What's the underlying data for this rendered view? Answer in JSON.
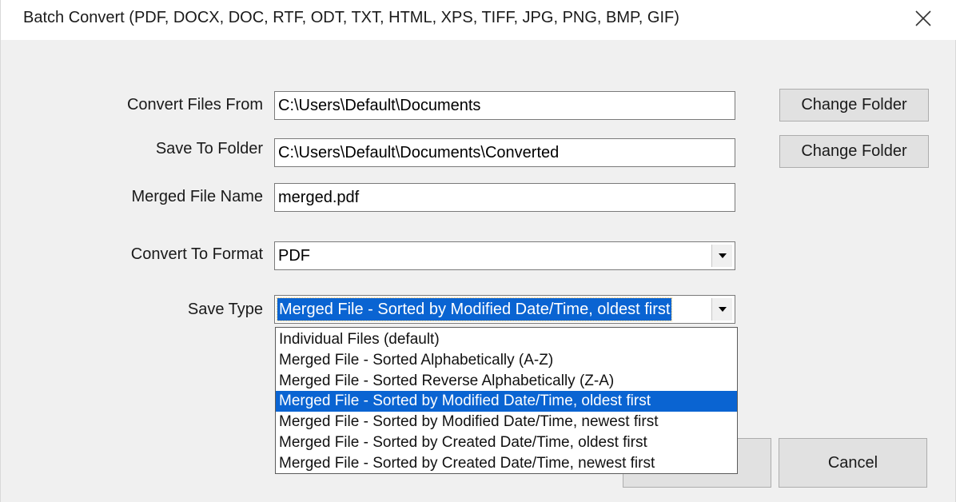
{
  "window": {
    "title": "Batch Convert (PDF, DOCX, DOC, RTF, ODT, TXT, HTML, XPS, TIFF, JPG, PNG, BMP, GIF)"
  },
  "form": {
    "convert_from": {
      "label": "Convert Files From",
      "value": "C:\\Users\\Default\\Documents",
      "button": "Change Folder"
    },
    "save_to": {
      "label": "Save To Folder",
      "value": "C:\\Users\\Default\\Documents\\Converted",
      "button": "Change Folder"
    },
    "merged_name": {
      "label": "Merged File Name",
      "value": "merged.pdf"
    },
    "format": {
      "label": "Convert To Format",
      "value": "PDF"
    },
    "save_type": {
      "label": "Save Type",
      "value": "Merged File - Sorted by Modified Date/Time, oldest first",
      "options": [
        "Individual Files (default)",
        "Merged File - Sorted Alphabetically (A-Z)",
        "Merged File - Sorted Reverse Alphabetically (Z-A)",
        "Merged File - Sorted by Modified Date/Time, oldest first",
        "Merged File - Sorted by Modified Date/Time, newest first",
        "Merged File - Sorted by Created Date/Time, oldest first",
        "Merged File - Sorted by Created Date/Time, newest first"
      ],
      "highlighted_index": 3
    }
  },
  "actions": {
    "cancel": "Cancel"
  },
  "icons": {
    "close": "close-icon",
    "dropdown": "chevron-down-icon"
  },
  "colors": {
    "selection": "#0a64d2",
    "window_bg": "#f0f0f0",
    "button_bg": "#e1e1e1"
  }
}
